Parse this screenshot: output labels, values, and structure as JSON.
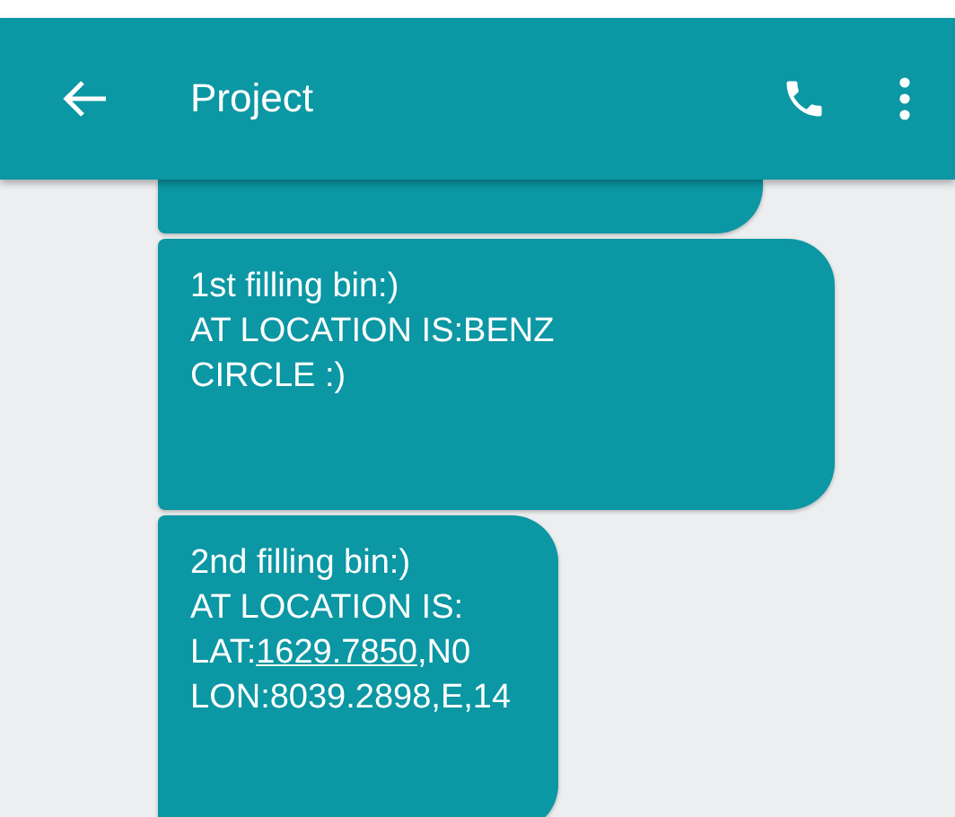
{
  "app_bar": {
    "title": "Project"
  },
  "messages": [
    {
      "cut_off": true
    },
    {
      "cut_off": false,
      "lines": [
        [
          {
            "text": "1st filling bin:)"
          }
        ],
        [
          {
            "text": "AT LOCATION IS:BENZ"
          }
        ],
        [
          {
            "text": "CIRCLE :)"
          }
        ]
      ]
    },
    {
      "cut_off": false,
      "lines": [
        [
          {
            "text": "2nd filling bin:)"
          }
        ],
        [
          {
            "text": "AT LOCATION IS:"
          }
        ],
        [
          {
            "text": "LAT:"
          },
          {
            "text": "1629.7850",
            "link": true
          },
          {
            "text": ",N0"
          }
        ],
        [
          {
            "text": "LON:8039.2898,E,14"
          }
        ]
      ]
    }
  ]
}
